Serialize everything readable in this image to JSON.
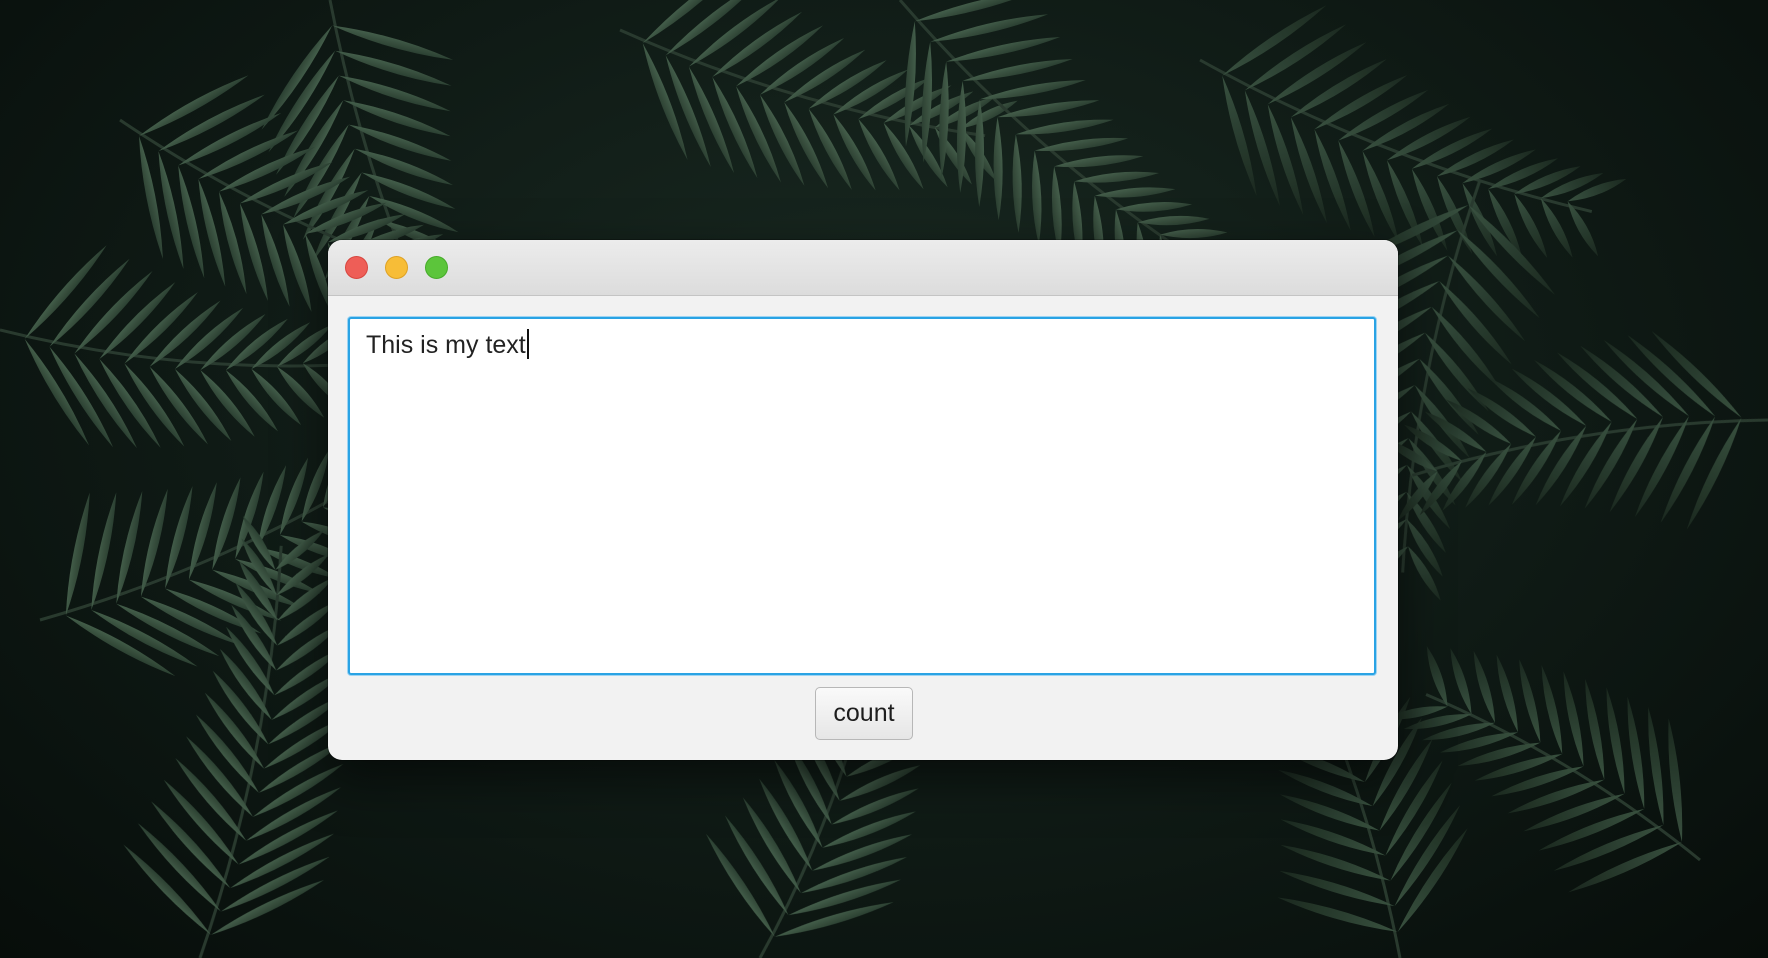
{
  "window": {
    "title": ""
  },
  "editor": {
    "value": "This is my text"
  },
  "actions": {
    "count_label": "count"
  },
  "colors": {
    "close": "#ee5e57",
    "minimize": "#f7bd37",
    "maximize": "#5cc53b",
    "focus_ring": "#2aa3e4"
  }
}
